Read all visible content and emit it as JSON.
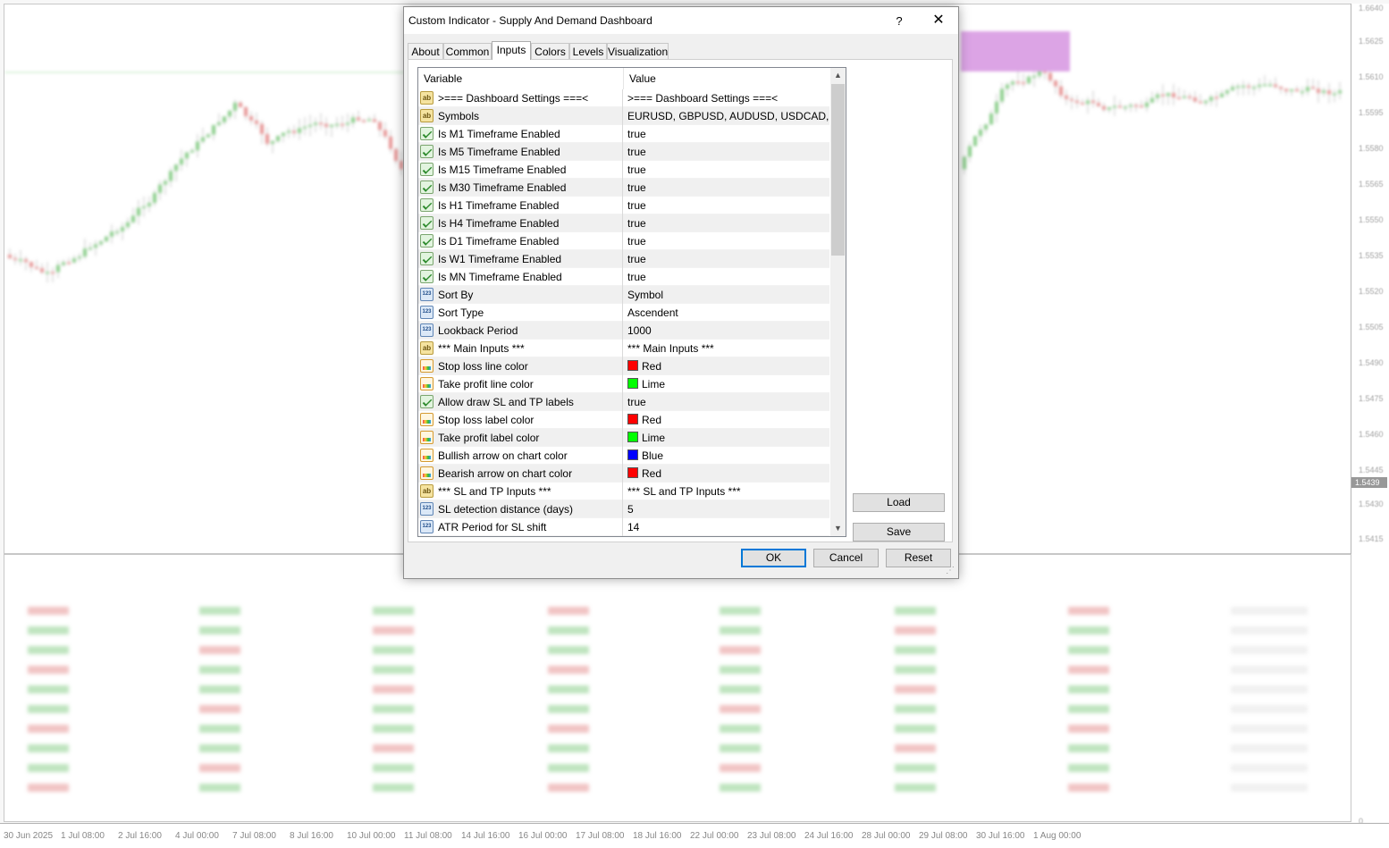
{
  "dialog": {
    "title": "Custom Indicator - Supply And Demand Dashboard",
    "help_label": "?",
    "close_label": "✕",
    "tabs": [
      {
        "label": "About"
      },
      {
        "label": "Common"
      },
      {
        "label": "Inputs"
      },
      {
        "label": "Colors"
      },
      {
        "label": "Levels"
      },
      {
        "label": "Visualization"
      }
    ],
    "active_tab": "Inputs",
    "grid": {
      "col_variable": "Variable",
      "col_value": "Value",
      "rows": [
        {
          "icon": "string-icon",
          "variable": ">=== Dashboard Settings ===<",
          "value": ">=== Dashboard Settings ===<"
        },
        {
          "icon": "string-icon",
          "variable": "Symbols",
          "value": "EURUSD, GBPUSD, AUDUSD, USDCAD, ..."
        },
        {
          "icon": "bool-icon",
          "variable": "Is M1 Timeframe Enabled",
          "value": "true"
        },
        {
          "icon": "bool-icon",
          "variable": "Is M5 Timeframe Enabled",
          "value": "true"
        },
        {
          "icon": "bool-icon",
          "variable": "Is M15 Timeframe Enabled",
          "value": "true"
        },
        {
          "icon": "bool-icon",
          "variable": "Is M30 Timeframe Enabled",
          "value": "true"
        },
        {
          "icon": "bool-icon",
          "variable": "Is H1 Timeframe Enabled",
          "value": "true"
        },
        {
          "icon": "bool-icon",
          "variable": "Is H4 Timeframe Enabled",
          "value": "true"
        },
        {
          "icon": "bool-icon",
          "variable": "Is D1 Timeframe Enabled",
          "value": "true"
        },
        {
          "icon": "bool-icon",
          "variable": "Is W1 Timeframe Enabled",
          "value": "true"
        },
        {
          "icon": "bool-icon",
          "variable": "Is MN Timeframe Enabled",
          "value": "true"
        },
        {
          "icon": "number-icon",
          "variable": "Sort By",
          "value": "Symbol"
        },
        {
          "icon": "number-icon",
          "variable": "Sort Type",
          "value": "Ascendent"
        },
        {
          "icon": "number-icon",
          "variable": "Lookback Period",
          "value": "1000"
        },
        {
          "icon": "string-icon",
          "variable": "*** Main Inputs ***",
          "value": "*** Main Inputs ***"
        },
        {
          "icon": "color-icon",
          "variable": "Stop loss line color",
          "value": "Red",
          "swatch": "#ff0000"
        },
        {
          "icon": "color-icon",
          "variable": "Take profit line color",
          "value": "Lime",
          "swatch": "#00ff00"
        },
        {
          "icon": "bool-icon",
          "variable": "Allow draw SL and TP labels",
          "value": "true"
        },
        {
          "icon": "color-icon",
          "variable": "Stop loss label color",
          "value": "Red",
          "swatch": "#ff0000"
        },
        {
          "icon": "color-icon",
          "variable": "Take profit label color",
          "value": "Lime",
          "swatch": "#00ff00"
        },
        {
          "icon": "color-icon",
          "variable": "Bullish arrow on chart color",
          "value": "Blue",
          "swatch": "#0000ff"
        },
        {
          "icon": "color-icon",
          "variable": "Bearish arrow on chart color",
          "value": "Red",
          "swatch": "#ff0000"
        },
        {
          "icon": "string-icon",
          "variable": "*** SL and TP Inputs ***",
          "value": "*** SL and TP Inputs ***"
        },
        {
          "icon": "number-icon",
          "variable": "SL detection distance (days)",
          "value": "5"
        },
        {
          "icon": "number-icon",
          "variable": "ATR Period for SL shift",
          "value": "14"
        }
      ]
    },
    "buttons": {
      "load": "Load",
      "save": "Save",
      "ok": "OK",
      "cancel": "Cancel",
      "reset": "Reset"
    },
    "icon_glyphs": {
      "string": "ab",
      "number": "123"
    }
  },
  "chart": {
    "price_labels": [
      "1.6640",
      "1.5625",
      "1.5610",
      "1.5595",
      "1.5580",
      "1.5565",
      "1.5550",
      "1.5535",
      "1.5520",
      "1.5505",
      "1.5490",
      "1.5475",
      "1.5460",
      "1.5445",
      "1.5439",
      "1.5430",
      "1.5415",
      "0"
    ],
    "time_labels": [
      "30 Jun 2025",
      "1 Jul 08:00",
      "2 Jul 16:00",
      "4 Jul 00:00",
      "7 Jul 08:00",
      "8 Jul 16:00",
      "10 Jul 00:00",
      "11 Jul 08:00",
      "14 Jul 16:00",
      "16 Jul 00:00",
      "17 Jul 08:00",
      "18 Jul 16:00",
      "22 Jul 00:00",
      "23 Jul 08:00",
      "24 Jul 16:00",
      "28 Jul 00:00",
      "29 Jul 08:00",
      "30 Jul 16:00",
      "1 Aug 00:00"
    ],
    "colors": {
      "bull": "#2aa52a",
      "bear": "#d23c3c",
      "panel_bg": "#ffffff"
    }
  }
}
